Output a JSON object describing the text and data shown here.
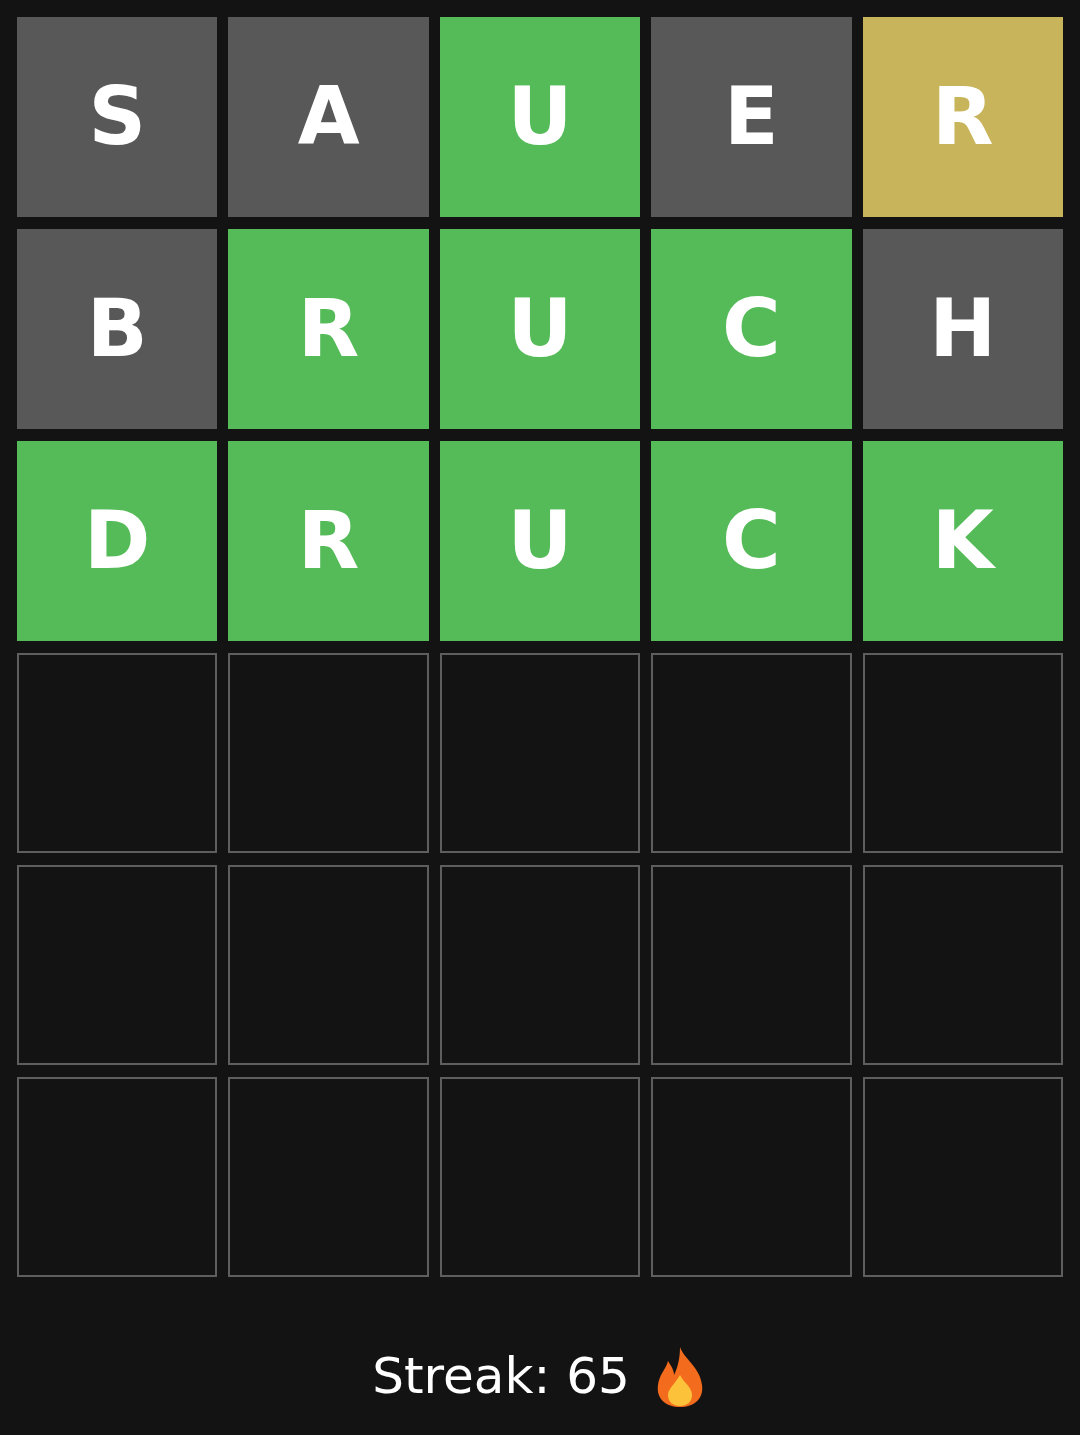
{
  "board": [
    {
      "tiles": [
        {
          "letter": "S",
          "kind": "absent"
        },
        {
          "letter": "A",
          "kind": "absent"
        },
        {
          "letter": "U",
          "kind": "correct"
        },
        {
          "letter": "E",
          "kind": "absent"
        },
        {
          "letter": "R",
          "kind": "present"
        }
      ]
    },
    {
      "tiles": [
        {
          "letter": "B",
          "kind": "absent"
        },
        {
          "letter": "R",
          "kind": "correct"
        },
        {
          "letter": "U",
          "kind": "correct"
        },
        {
          "letter": "C",
          "kind": "correct"
        },
        {
          "letter": "H",
          "kind": "absent"
        }
      ]
    },
    {
      "tiles": [
        {
          "letter": "D",
          "kind": "correct"
        },
        {
          "letter": "R",
          "kind": "correct"
        },
        {
          "letter": "U",
          "kind": "correct"
        },
        {
          "letter": "C",
          "kind": "correct"
        },
        {
          "letter": "K",
          "kind": "correct"
        }
      ]
    },
    {
      "tiles": [
        {
          "kind": "empty"
        },
        {
          "kind": "empty"
        },
        {
          "kind": "empty"
        },
        {
          "kind": "empty"
        },
        {
          "kind": "empty"
        }
      ]
    },
    {
      "tiles": [
        {
          "kind": "empty"
        },
        {
          "kind": "empty"
        },
        {
          "kind": "empty"
        },
        {
          "kind": "empty"
        },
        {
          "kind": "empty"
        }
      ]
    },
    {
      "tiles": [
        {
          "kind": "empty"
        },
        {
          "kind": "empty"
        },
        {
          "kind": "empty"
        },
        {
          "kind": "empty"
        },
        {
          "kind": "empty"
        }
      ]
    }
  ],
  "streak": {
    "label": "Streak: 65"
  }
}
